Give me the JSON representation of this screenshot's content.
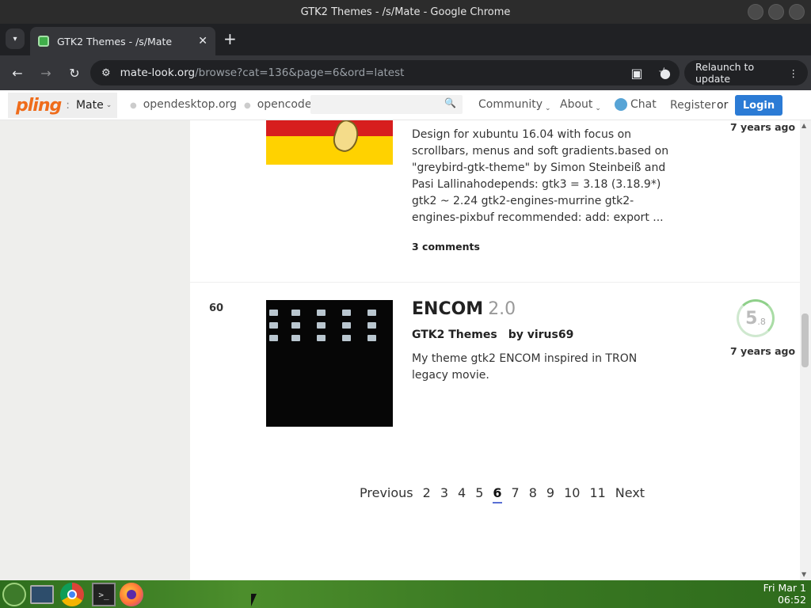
{
  "window": {
    "title": "GTK2 Themes - /s/Mate - Google Chrome"
  },
  "tab": {
    "title": "GTK2 Themes - /s/Mate",
    "close": "✕",
    "new_tab": "+"
  },
  "toolbar": {
    "url_host": "mate-look.org",
    "url_path": "/browse?cat=136&page=6&ord=latest",
    "relaunch_label": "Relaunch to update",
    "relaunch_menu": "⋮"
  },
  "icons": {
    "back": "←",
    "forward": "→",
    "reload": "↻",
    "site_info": "⚙",
    "bookmark": "☆",
    "side_panel": "▣",
    "profile": "●",
    "search": "🔍",
    "tab_list": "▾"
  },
  "sitenav": {
    "logo": "pling",
    "colon": ":",
    "store": "Mate",
    "opendesktop": "opendesktop.org",
    "opencode": "opencode.i",
    "community": "Community",
    "about": "About",
    "chat": "Chat",
    "register": "Register",
    "or": "or",
    "login": "Login",
    "caret": "⌄",
    "bullet": "●"
  },
  "items": [
    {
      "description": "Design for xubuntu 16.04 with focus on scrollbars, menus and soft gradients.based on \"greybird-gtk-theme\" by Simon Steinbeiß and Pasi Lallinahodepends: gtk3 = 3.18 (3.18.9*) gtk2 ~ 2.24 gtk2-engines-murrine gtk2-engines-pixbuf recommended: add: export ...",
      "comments": "3 comments",
      "age": "7 years ago"
    },
    {
      "rank": "60",
      "title": "ENCOM",
      "version": "2.0",
      "category": "GTK2 Themes",
      "author": "by virus69",
      "description": "My theme gtk2 ENCOM inspired in TRON legacy movie.",
      "rating_main": "5",
      "rating_dec": ".8",
      "age": "7 years ago"
    }
  ],
  "pager": {
    "previous": "Previous",
    "pages": [
      "2",
      "3",
      "4",
      "5",
      "6",
      "7",
      "8",
      "9",
      "10",
      "11"
    ],
    "current": "6",
    "next": "Next"
  },
  "taskbar": {
    "clock_day": "Fri Mar 1",
    "clock_time": "06:52",
    "terminal_glyph": ">_"
  },
  "scrollbar": {
    "up": "▲",
    "down": "▼"
  }
}
